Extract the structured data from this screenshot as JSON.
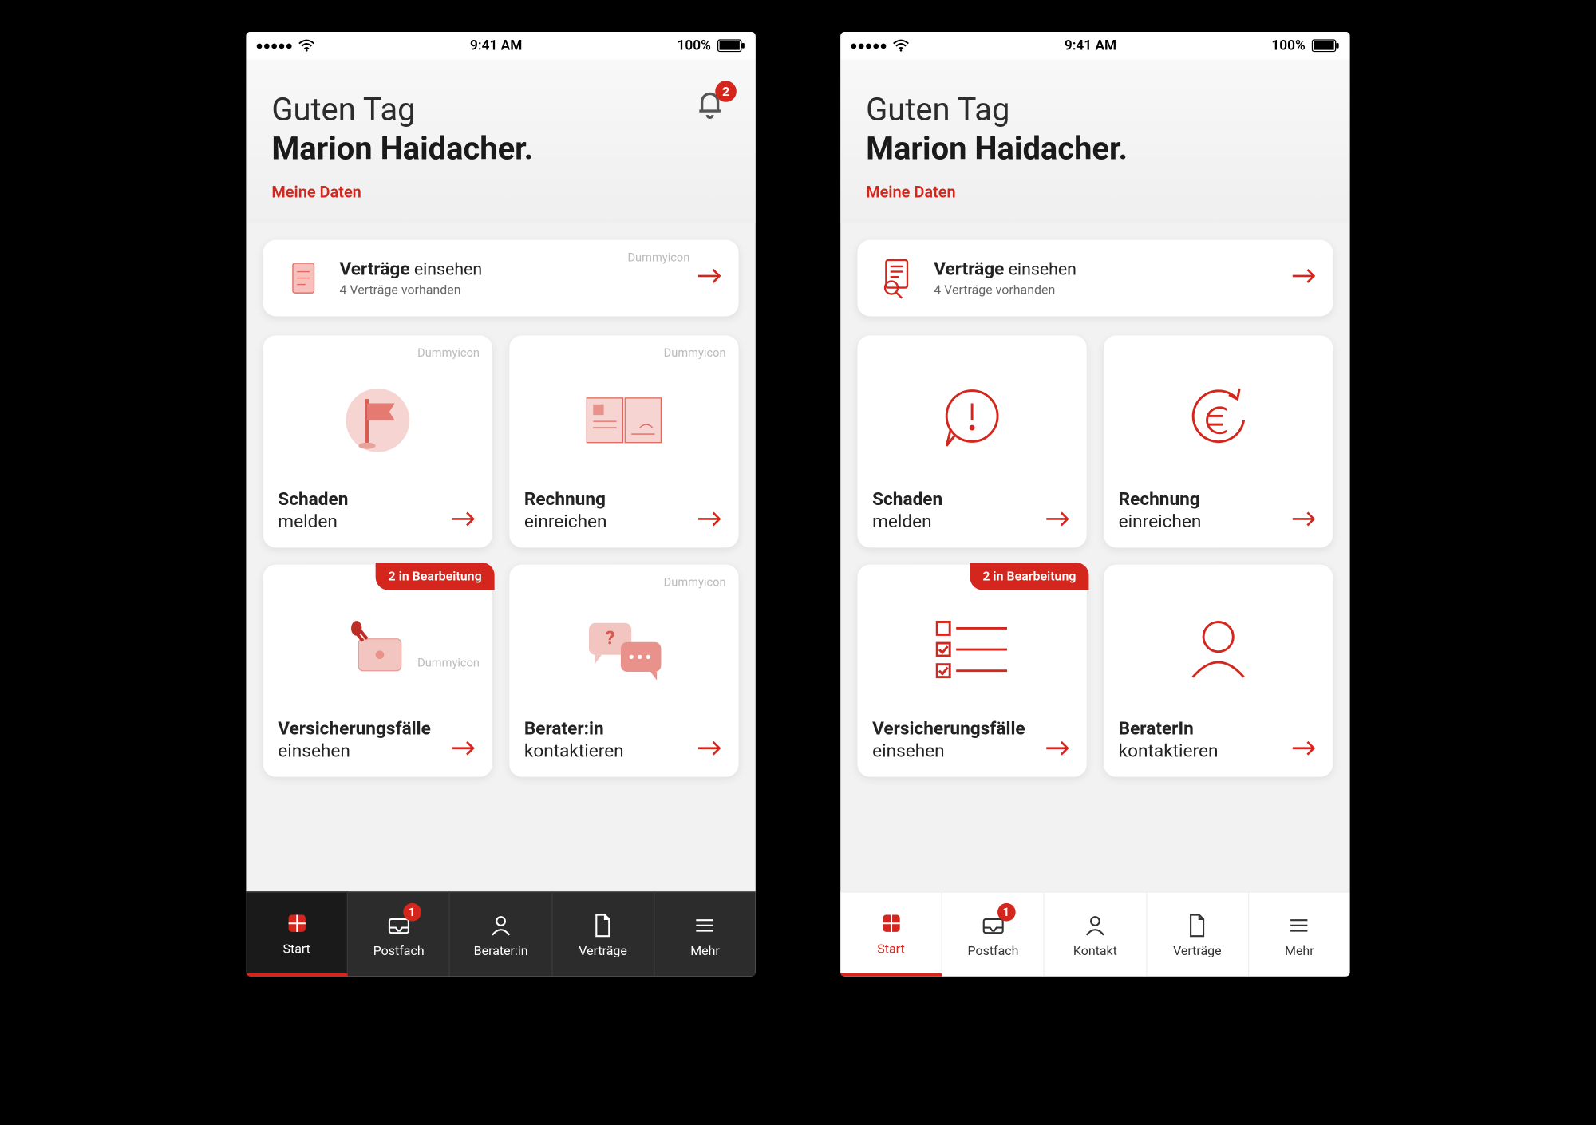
{
  "statusbar": {
    "time": "9:41 AM",
    "battery": "100%"
  },
  "header": {
    "greeting": "Guten Tag",
    "name": "Marion Haidacher.",
    "meineDaten": "Meine Daten",
    "notifBadge": "2"
  },
  "widecard": {
    "titleBold": "Verträge",
    "titleLight": "einsehen",
    "sub": "4 Verträge vorhanden",
    "dummy": "Dummyicon"
  },
  "tiles": {
    "schaden": {
      "bold": "Schaden",
      "reg": "melden",
      "dummy": "Dummyicon"
    },
    "rechnung": {
      "bold": "Rechnung",
      "reg": "einreichen",
      "dummy": "Dummyicon"
    },
    "faelle": {
      "bold": "Versicherungsfälle",
      "reg": "einsehen",
      "ribbon": "2 in Bearbeitung",
      "dummy": "Dummyicon"
    },
    "beraterA": {
      "bold": "Berater:in",
      "reg": "kontaktieren",
      "dummy": "Dummyicon"
    },
    "beraterB": {
      "bold": "BeraterIn",
      "reg": "kontaktieren"
    }
  },
  "navA": {
    "start": "Start",
    "postfach": "Postfach",
    "berater": "Berater:in",
    "vertraege": "Verträge",
    "mehr": "Mehr",
    "postBadge": "1"
  },
  "navB": {
    "start": "Start",
    "postfach": "Postfach",
    "kontakt": "Kontakt",
    "vertraege": "Verträge",
    "mehr": "Mehr",
    "postBadge": "1"
  }
}
